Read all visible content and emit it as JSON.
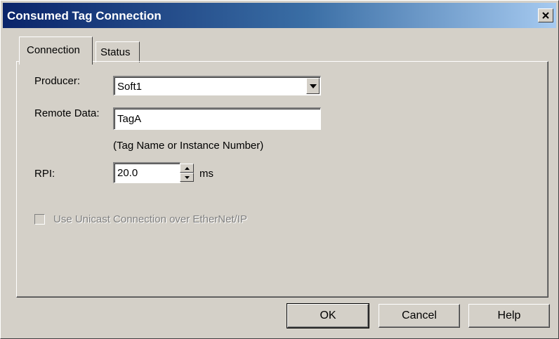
{
  "window": {
    "title": "Consumed Tag Connection"
  },
  "tabs": [
    {
      "label": "Connection",
      "active": true
    },
    {
      "label": "Status",
      "active": false
    }
  ],
  "form": {
    "producer_label": "Producer:",
    "producer_value": "Soft1",
    "remote_data_label": "Remote Data:",
    "remote_data_value": "TagA",
    "remote_data_hint": "(Tag Name or Instance Number)",
    "rpi_label": "RPI:",
    "rpi_value": "20.0",
    "rpi_unit": "ms",
    "unicast_label": "Use Unicast Connection over EtherNet/IP",
    "unicast_checked": false,
    "unicast_enabled": false
  },
  "buttons": {
    "ok": "OK",
    "cancel": "Cancel",
    "help": "Help"
  }
}
